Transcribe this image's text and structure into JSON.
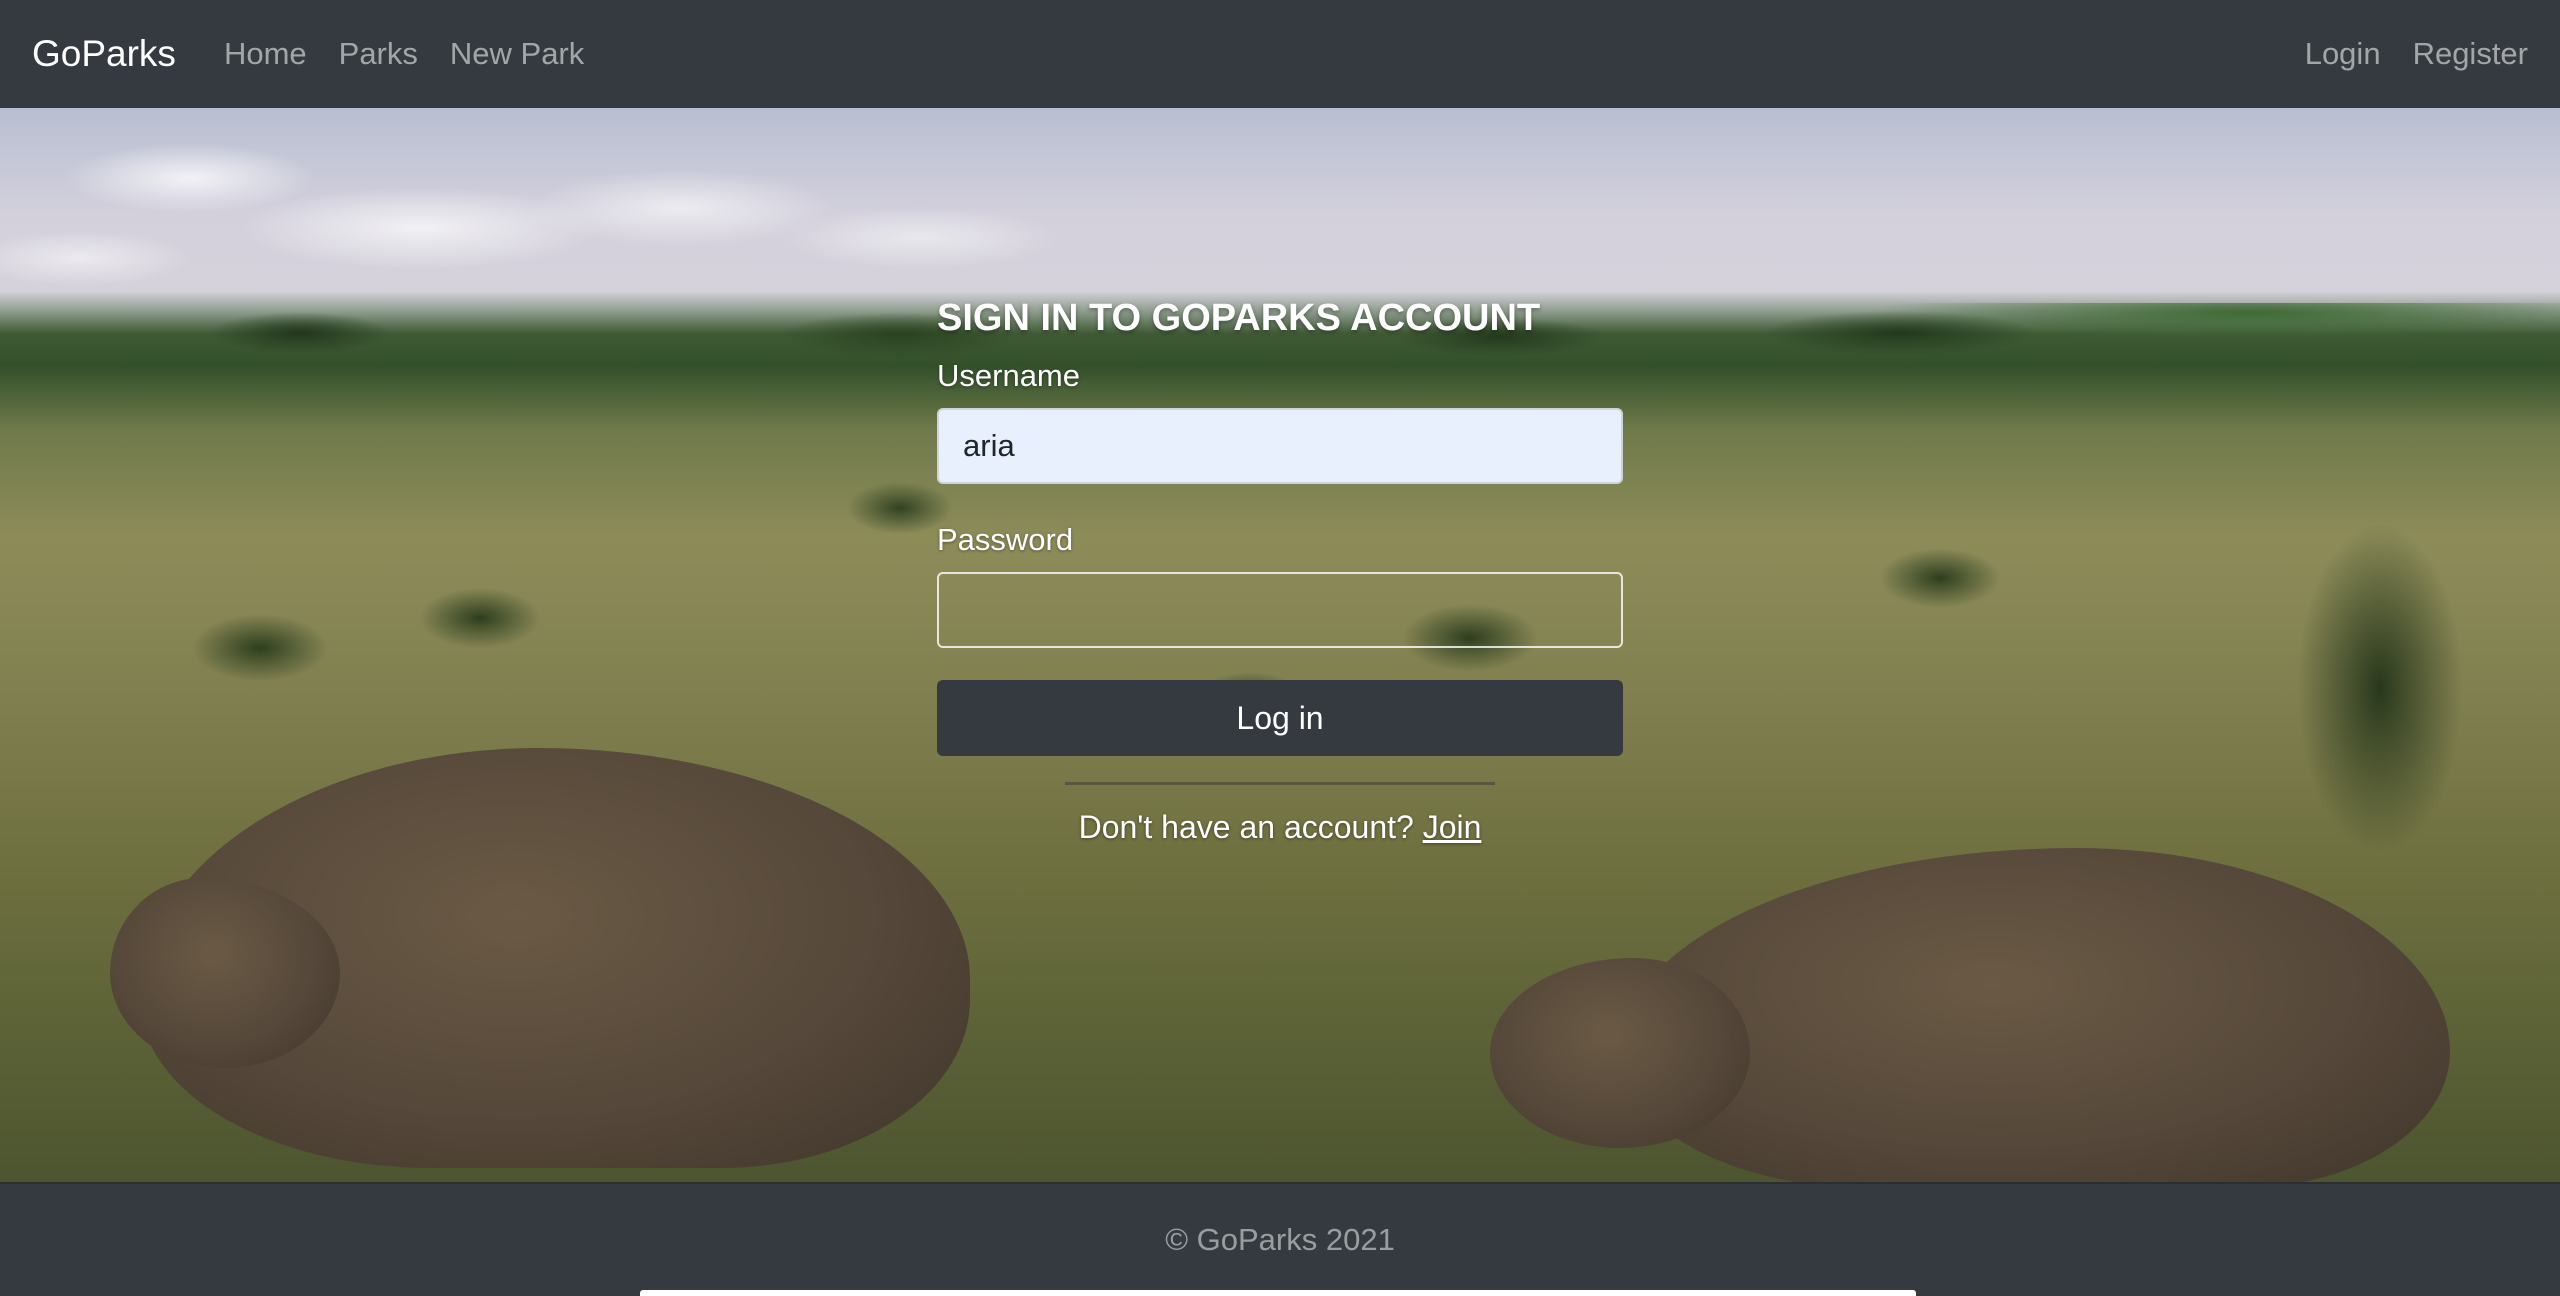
{
  "navbar": {
    "brand": "GoParks",
    "links": [
      "Home",
      "Parks",
      "New Park"
    ],
    "auth_links": [
      "Login",
      "Register"
    ]
  },
  "login_form": {
    "title": "SIGN IN TO GOPARKS ACCOUNT",
    "username_label": "Username",
    "username_value": "aria",
    "password_label": "Password",
    "password_value": "",
    "submit_label": "Log in",
    "signup_prompt": "Don't have an account?",
    "signup_link": "Join"
  },
  "footer": {
    "text": "© GoParks 2021"
  },
  "colors": {
    "navbar_bg": "#343a40",
    "nav_link": "rgba(255,255,255,0.55)",
    "button_bg": "#343a40",
    "autofill_bg": "#e8f0fe"
  }
}
